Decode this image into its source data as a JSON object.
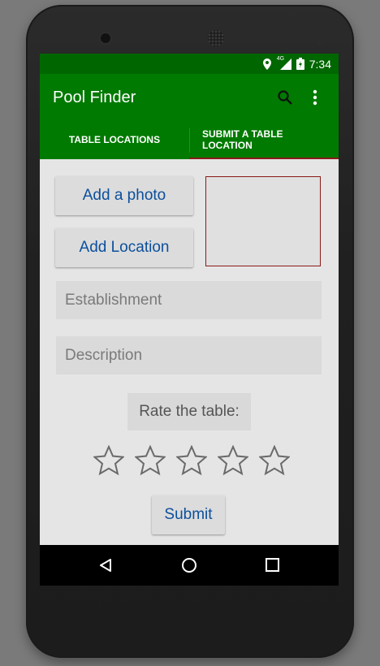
{
  "statusbar": {
    "time": "7:34",
    "network": "4G"
  },
  "app": {
    "title": "Pool Finder"
  },
  "tabs": [
    {
      "label": "TABLE LOCATIONS"
    },
    {
      "label": "SUBMIT A TABLE LOCATION"
    }
  ],
  "form": {
    "add_photo_label": "Add a photo",
    "add_location_label": "Add Location",
    "establishment_placeholder": "Establishment",
    "description_placeholder": "Description",
    "rate_label": "Rate the table:",
    "rating": 0,
    "max_rating": 5,
    "submit_label": "Submit"
  },
  "colors": {
    "primary": "#007a00",
    "primary_dark": "#006600",
    "accent": "#8b1a1a",
    "button_text": "#0b4f9c"
  }
}
